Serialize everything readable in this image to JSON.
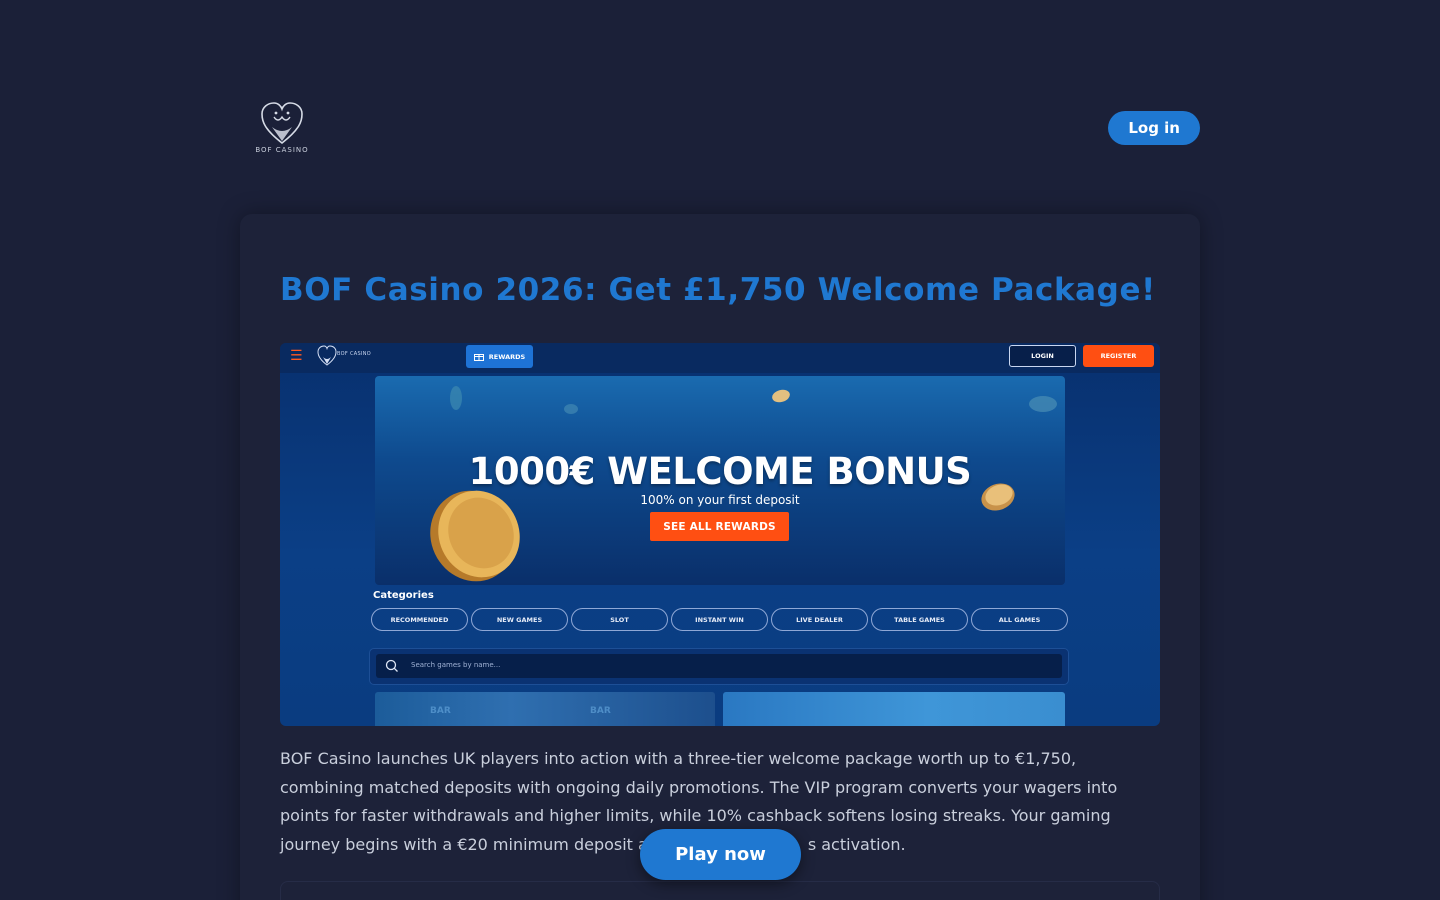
{
  "header": {
    "logo_text": "BOF CASINO",
    "login_label": "Log in"
  },
  "article": {
    "title": "BOF Casino 2026: Get £1,750 Welcome Package!",
    "description": "BOF Casino launches UK players into action with a three-tier welcome package worth up to €1,750, combining matched deposits with ongoing daily promotions. The VIP program converts your wagers into points for faster withdrawals and higher limits, while 10% cashback softens losing streaks. Your gaming journey begins with a €20 minimum deposit a",
    "description_tail": "s activation."
  },
  "screenshot": {
    "logo_text": "BOF CASINO",
    "rewards_label": "REWARDS",
    "login_label": "LOGIN",
    "register_label": "REGISTER",
    "hero_title": "1000€ WELCOME BONUS",
    "hero_subtitle": "100% on your first deposit",
    "hero_cta": "SEE ALL REWARDS",
    "categories_label": "Categories",
    "categories": [
      "RECOMMENDED",
      "NEW GAMES",
      "SLOT",
      "INSTANT WIN",
      "LIVE DEALER",
      "TABLE GAMES",
      "ALL GAMES"
    ],
    "search_placeholder": "Search games by name...",
    "tile_text": "BAR"
  },
  "play_label": "Play now",
  "colors": {
    "background": "#1b2038",
    "accent": "#1f78d1",
    "orange": "#ff4f12"
  }
}
